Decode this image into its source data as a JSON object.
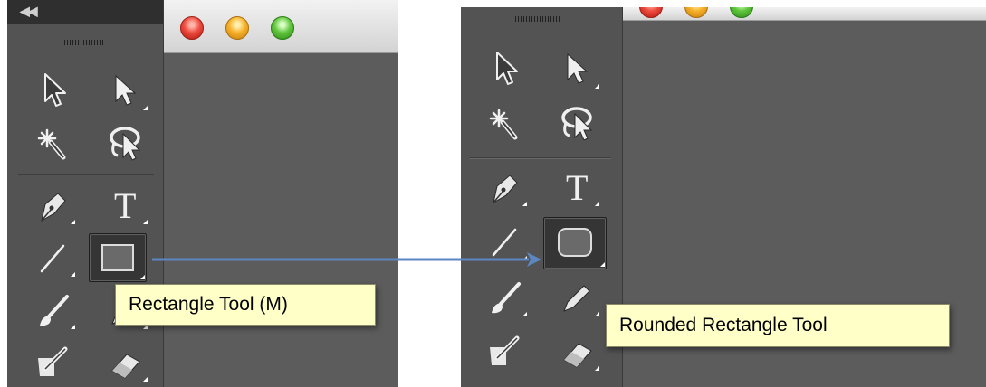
{
  "left_panel": {
    "collapse_icon": "double-chevron-left-icon",
    "tools": [
      {
        "name": "selection-tool",
        "icon": "arrow-outline-icon"
      },
      {
        "name": "direct-selection-tool",
        "icon": "arrow-filled-icon"
      },
      {
        "name": "magic-wand-tool",
        "icon": "magic-wand-icon"
      },
      {
        "name": "lasso-tool",
        "icon": "lasso-icon"
      },
      {
        "name": "pen-tool",
        "icon": "pen-icon"
      },
      {
        "name": "type-tool",
        "icon": "type-icon",
        "glyph": "T"
      },
      {
        "name": "line-segment-tool",
        "icon": "line-icon"
      },
      {
        "name": "rectangle-tool",
        "icon": "rectangle-icon",
        "selected": true
      },
      {
        "name": "paintbrush-tool",
        "icon": "paintbrush-icon"
      },
      {
        "name": "pencil-tool",
        "icon": "pencil-icon"
      },
      {
        "name": "shaper-tool",
        "icon": "shaper-icon"
      },
      {
        "name": "eraser-tool",
        "icon": "eraser-icon"
      }
    ],
    "tooltip": "Rectangle Tool (M)"
  },
  "right_panel": {
    "tools": [
      {
        "name": "selection-tool",
        "icon": "arrow-outline-icon"
      },
      {
        "name": "direct-selection-tool",
        "icon": "arrow-filled-icon"
      },
      {
        "name": "magic-wand-tool",
        "icon": "magic-wand-icon"
      },
      {
        "name": "lasso-tool",
        "icon": "lasso-icon"
      },
      {
        "name": "pen-tool",
        "icon": "pen-icon"
      },
      {
        "name": "type-tool",
        "icon": "type-icon",
        "glyph": "T"
      },
      {
        "name": "line-segment-tool",
        "icon": "line-icon"
      },
      {
        "name": "rounded-rectangle-tool",
        "icon": "rounded-rectangle-icon",
        "selected": true
      },
      {
        "name": "paintbrush-tool",
        "icon": "paintbrush-icon"
      },
      {
        "name": "pencil-tool",
        "icon": "pencil-icon"
      },
      {
        "name": "shaper-tool",
        "icon": "shaper-icon"
      },
      {
        "name": "eraser-tool",
        "icon": "eraser-icon"
      }
    ],
    "tooltip": "Rounded Rectangle Tool"
  },
  "window_controls": [
    "close-button",
    "minimize-button",
    "zoom-button"
  ],
  "colors": {
    "toolbar_bg": "#535353",
    "canvas_bg": "#5c5c5c",
    "tooltip_bg": "#ffffc8",
    "arrow": "#5b86c0"
  }
}
